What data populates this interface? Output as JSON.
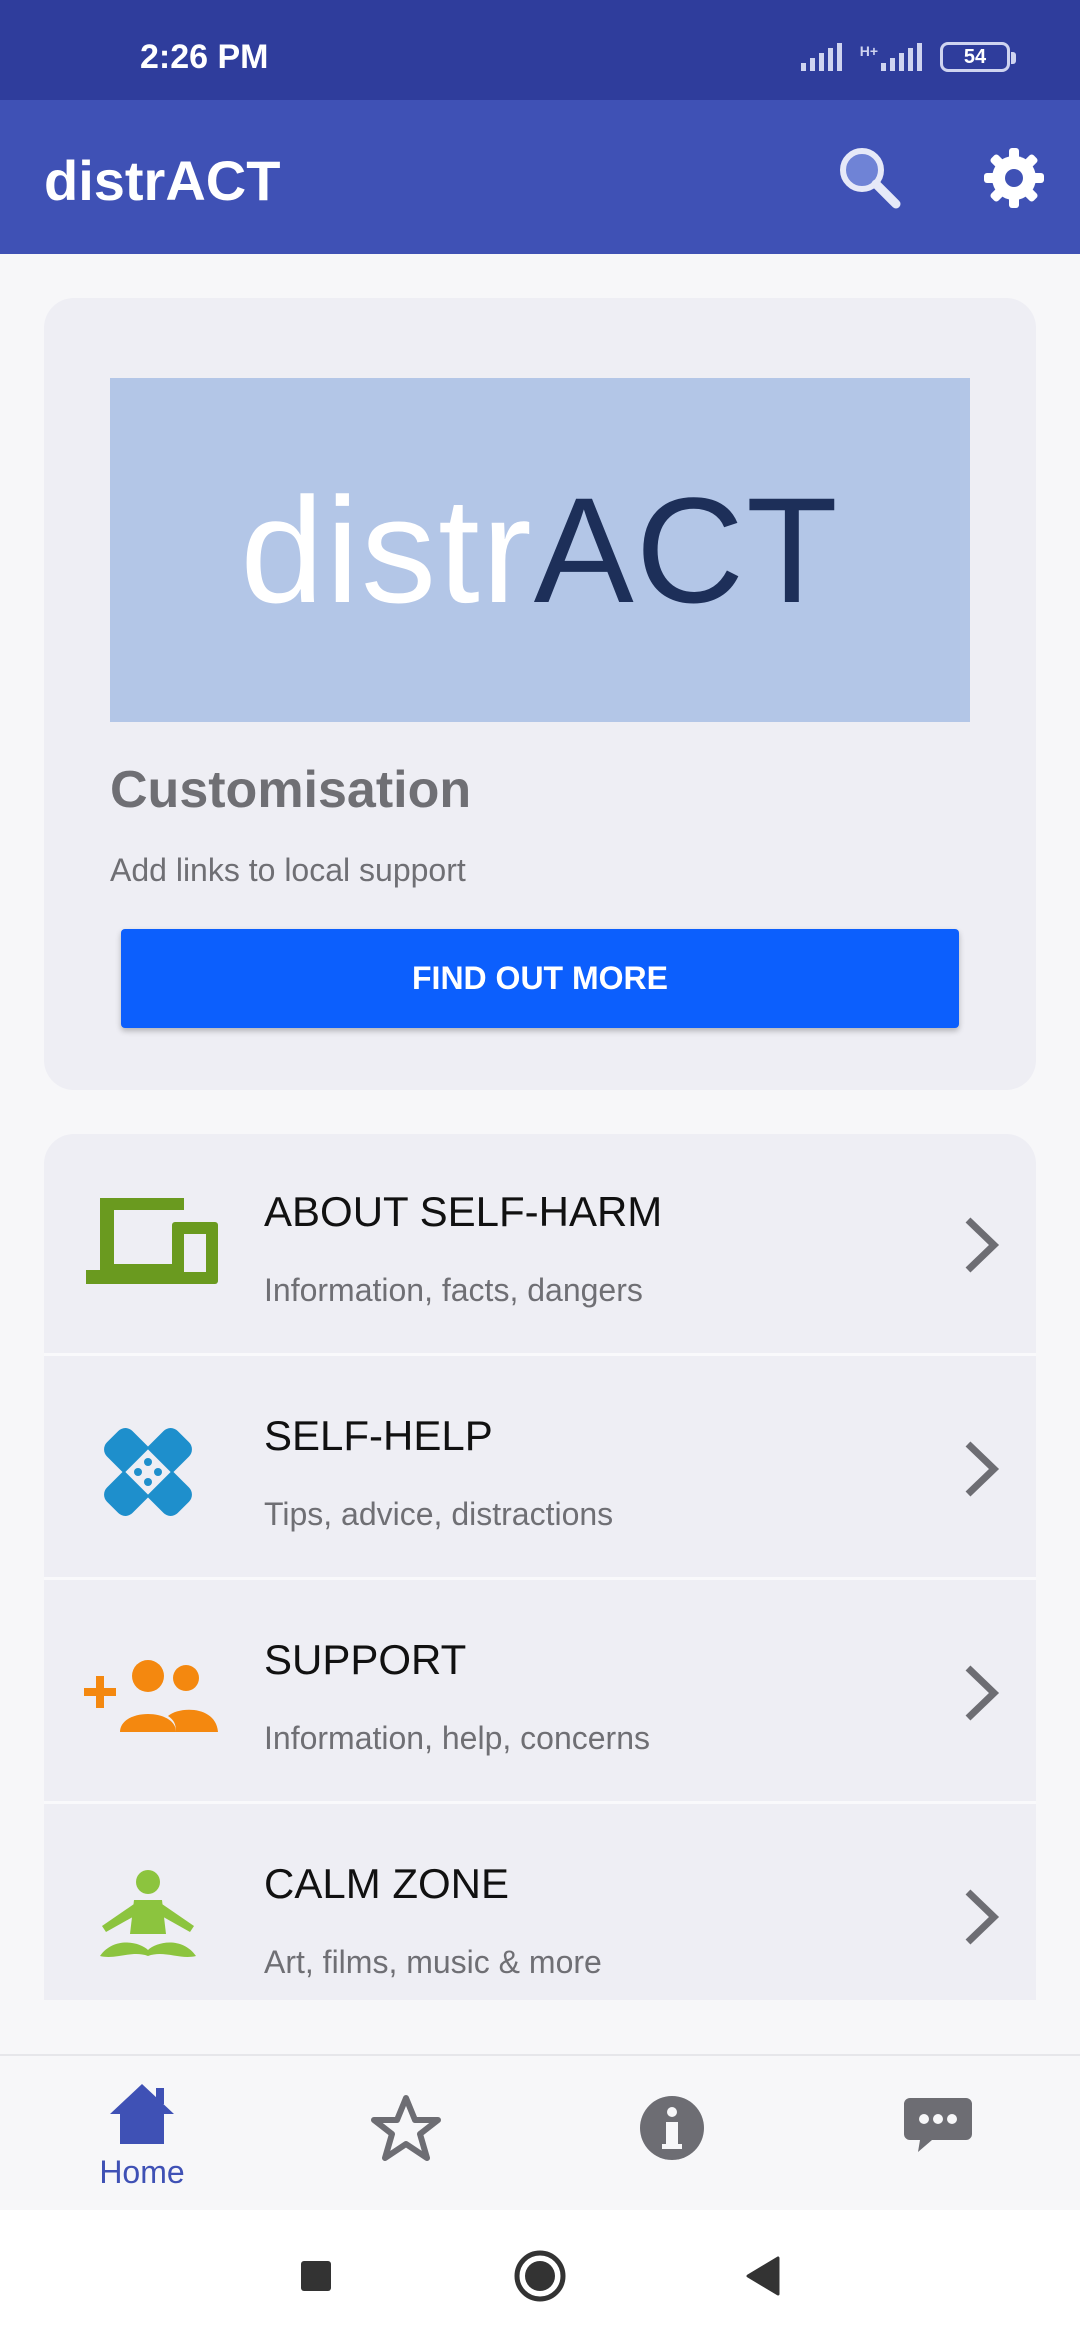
{
  "status_bar": {
    "time": "2:26 PM",
    "network": "H+",
    "battery": "54"
  },
  "app_bar": {
    "title": "distrACT"
  },
  "customisation_card": {
    "logo_part_light": "distr",
    "logo_part_dark": "ACT",
    "title": "Customisation",
    "subtitle": "Add links to local support",
    "button_label": "FIND OUT MORE"
  },
  "menu": {
    "items": [
      {
        "title": "ABOUT SELF-HARM",
        "subtitle": "Information, facts, dangers",
        "icon": "devices-icon",
        "color": "#6a9a1f"
      },
      {
        "title": "SELF-HELP",
        "subtitle": "Tips, advice, distractions",
        "icon": "bandage-icon",
        "color": "#1e8fcc"
      },
      {
        "title": "SUPPORT",
        "subtitle": "Information, help, concerns",
        "icon": "add-group-icon",
        "color": "#f4880f"
      },
      {
        "title": "CALM ZONE",
        "subtitle": "Art, films, music & more",
        "icon": "meditation-icon",
        "color": "#8cc43e"
      }
    ]
  },
  "bottom_nav": {
    "items": [
      {
        "label": "Home",
        "icon": "home-icon",
        "active": true
      },
      {
        "label": "",
        "icon": "star-icon",
        "active": false
      },
      {
        "label": "",
        "icon": "info-icon",
        "active": false
      },
      {
        "label": "",
        "icon": "chat-icon",
        "active": false
      }
    ]
  },
  "colors": {
    "status_bar": "#2f3d9c",
    "app_bar": "#3f51b5",
    "primary_button": "#0c5ffd",
    "card_background": "#eeeef4",
    "banner": "#b3c6e7"
  }
}
